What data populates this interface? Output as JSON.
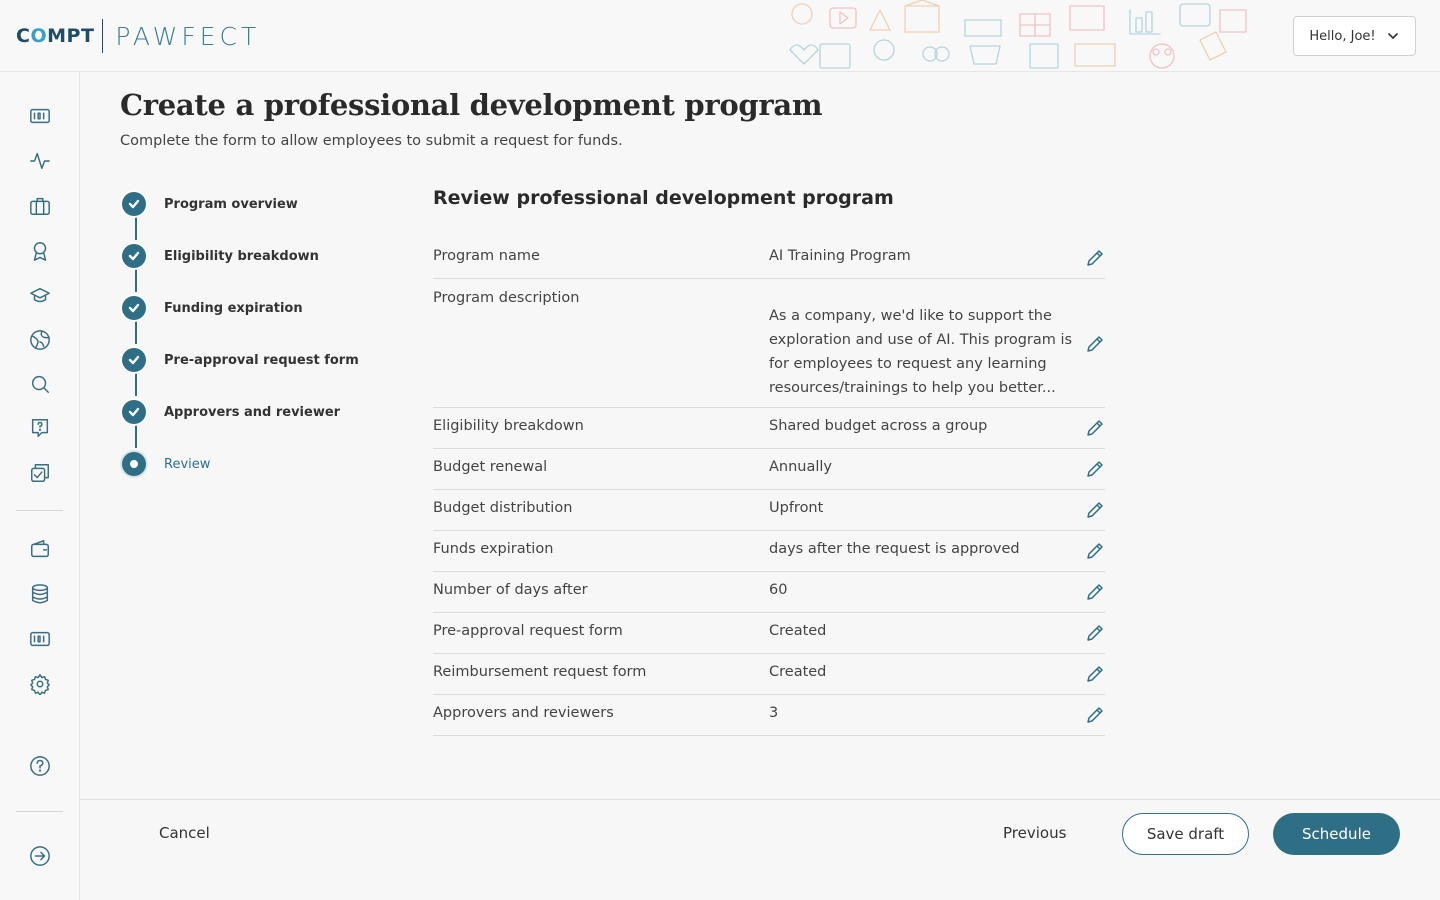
{
  "header": {
    "logo_compt": "COMPT",
    "logo_pawfect": "PAWFECT",
    "greeting": "Hello, Joe!"
  },
  "sidebar": {
    "icons": [
      "id-card-icon",
      "activity-icon",
      "briefcase-icon",
      "award-icon",
      "graduation-cap-icon",
      "globe-icon",
      "search-icon",
      "help-message-icon",
      "copy-check-icon",
      "wallet-icon",
      "database-icon",
      "id-card-icon",
      "gear-icon",
      "help-circle-icon",
      "logout-icon"
    ]
  },
  "page": {
    "title": "Create a professional development program",
    "subtitle": "Complete the form to allow employees to submit a request for funds."
  },
  "stepper": {
    "steps": [
      {
        "label": "Program overview",
        "status": "done"
      },
      {
        "label": "Eligibility breakdown",
        "status": "done"
      },
      {
        "label": "Funding expiration",
        "status": "done"
      },
      {
        "label": "Pre-approval request form",
        "status": "done"
      },
      {
        "label": "Approvers and reviewer",
        "status": "done"
      },
      {
        "label": "Review",
        "status": "active"
      }
    ]
  },
  "review": {
    "title": "Review professional development program",
    "rows": [
      {
        "label": "Program name",
        "value": "AI Training Program"
      },
      {
        "label": "Program description",
        "value": "As a company, we'd like to support the exploration and use of AI. This program is for employees to request any learning resources/trainings to help you better..."
      },
      {
        "label": "Eligibility breakdown",
        "value": "Shared budget across a group"
      },
      {
        "label": "Budget renewal",
        "value": "Annually"
      },
      {
        "label": "Budget distribution",
        "value": "Upfront"
      },
      {
        "label": "Funds expiration",
        "value": "days after the request is approved"
      },
      {
        "label": "Number of days after",
        "value": "60"
      },
      {
        "label": "Pre-approval request form",
        "value": "Created"
      },
      {
        "label": "Reimbursement request form",
        "value": "Created"
      },
      {
        "label": "Approvers and reviewers",
        "value": "3"
      }
    ]
  },
  "footer": {
    "cancel": "Cancel",
    "previous": "Previous",
    "save_draft": "Save draft",
    "schedule": "Schedule"
  },
  "colors": {
    "accent": "#2f6f86",
    "brand_dark": "#1f4d66",
    "brand_light": "#3a9ec7"
  }
}
